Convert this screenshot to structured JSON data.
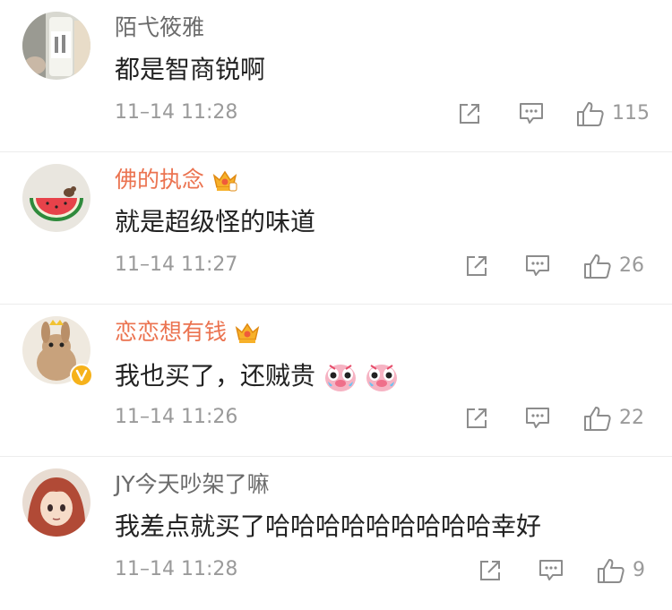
{
  "comments": [
    {
      "username": "陌弋筱雅",
      "vip": false,
      "text": "都是智商锐啊",
      "time": "11–14 11:28",
      "likes": "115",
      "avatar_icon": "milk-bottle-avatar"
    },
    {
      "username": "佛的执念",
      "vip": true,
      "text": "就是超级怪的味道",
      "time": "11–14 11:27",
      "likes": "26",
      "avatar_icon": "watermelon-avatar"
    },
    {
      "username": "恋恋想有钱",
      "vip": true,
      "verified": true,
      "text": "我也买了，还贼贵",
      "time": "11–14 11:26",
      "likes": "22",
      "emojis": [
        "crying-pig-emoji",
        "crying-pig-emoji"
      ],
      "avatar_icon": "rabbit-avatar"
    },
    {
      "username": "JY今天吵架了嘛",
      "vip": false,
      "text": "我差点就买了哈哈哈哈哈哈哈哈哈幸好",
      "time": "11–14 11:28",
      "likes": "9",
      "avatar_icon": "anime-girl-avatar"
    }
  ],
  "colors": {
    "vip_name": "#eb7350",
    "normal_name": "#6b6b6b",
    "meta": "#9a9a9a",
    "text": "#222222",
    "divider": "#ececec"
  }
}
